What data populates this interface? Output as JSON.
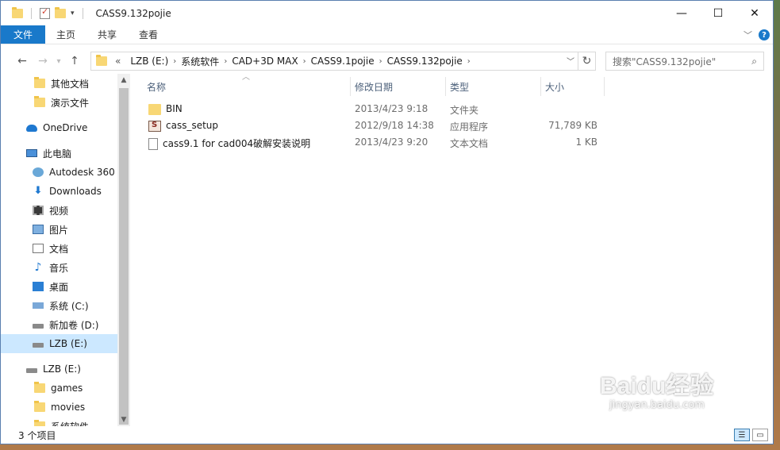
{
  "window": {
    "title": "CASS9.132pojie",
    "controls": {
      "minimize": "—",
      "maximize": "☐",
      "close": "✕"
    }
  },
  "ribbon": {
    "tabs": [
      "文件",
      "主页",
      "共享",
      "查看"
    ],
    "collapse_icon": "chevron-down-icon",
    "help_label": "?"
  },
  "address": {
    "overflow": "«",
    "crumbs": [
      "LZB (E:)",
      "系统软件",
      "CAD+3D MAX",
      "CASS9.1pojie",
      "CASS9.132pojie"
    ]
  },
  "search": {
    "placeholder": "搜索\"CASS9.132pojie\""
  },
  "navpane": {
    "items": [
      {
        "label": "其他文档",
        "icon": "folder-icon"
      },
      {
        "label": "演示文件",
        "icon": "folder-icon"
      },
      {
        "label": "OneDrive",
        "icon": "onedrive-icon"
      },
      {
        "label": "此电脑",
        "icon": "computer-icon"
      },
      {
        "label": "Autodesk 360",
        "icon": "autodesk-360-icon"
      },
      {
        "label": "Downloads",
        "icon": "download-icon"
      },
      {
        "label": "视频",
        "icon": "video-icon"
      },
      {
        "label": "图片",
        "icon": "picture-icon"
      },
      {
        "label": "文档",
        "icon": "document-icon"
      },
      {
        "label": "音乐",
        "icon": "music-icon"
      },
      {
        "label": "桌面",
        "icon": "desktop-icon"
      },
      {
        "label": "系统 (C:)",
        "icon": "system-drive-icon"
      },
      {
        "label": "新加卷 (D:)",
        "icon": "drive-icon"
      },
      {
        "label": "LZB (E:)",
        "icon": "drive-icon",
        "selected": true
      },
      {
        "label": "LZB (E:)",
        "icon": "drive-icon"
      },
      {
        "label": "games",
        "icon": "folder-icon"
      },
      {
        "label": "movies",
        "icon": "folder-icon"
      },
      {
        "label": "系统软件",
        "icon": "folder-icon"
      }
    ]
  },
  "columns": {
    "name": "名称",
    "date": "修改日期",
    "type": "类型",
    "size": "大小"
  },
  "files": [
    {
      "name": "BIN",
      "date": "2013/4/23 9:18",
      "type": "文件夹",
      "size": "",
      "icon": "folder-icon"
    },
    {
      "name": "cass_setup",
      "date": "2012/9/18 14:38",
      "type": "应用程序",
      "size": "71,789 KB",
      "icon": "application-icon"
    },
    {
      "name": "cass9.1 for cad004破解安装说明",
      "date": "2013/4/23 9:20",
      "type": "文本文档",
      "size": "1 KB",
      "icon": "text-file-icon"
    }
  ],
  "status": {
    "count": "3 个项目"
  },
  "watermark": {
    "brand": "Baidu经验",
    "url": "jingyan.baidu.com"
  }
}
